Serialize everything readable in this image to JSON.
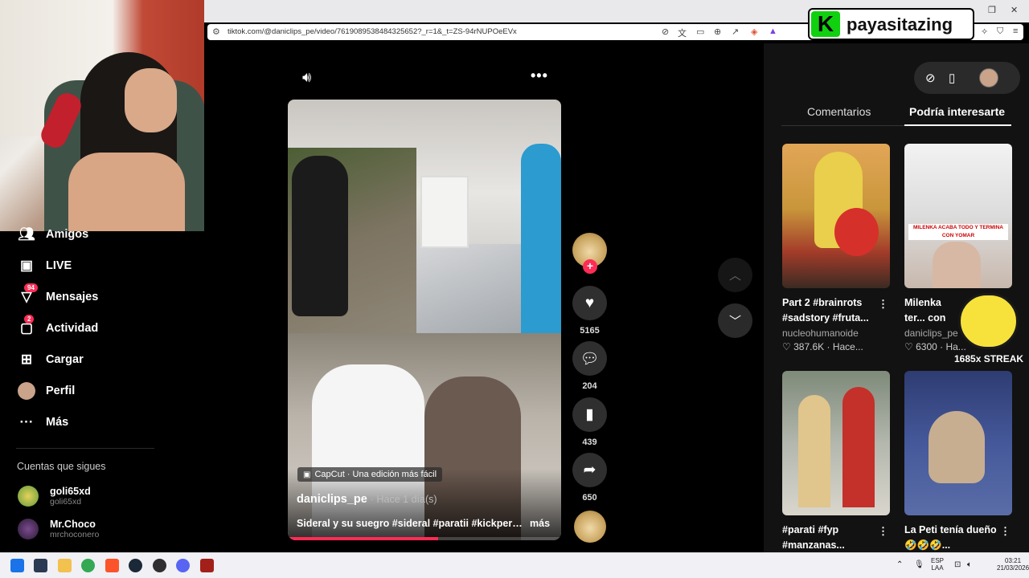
{
  "browser": {
    "url": "tiktok.com/@daniclips_pe/video/7619089538484325652?_r=1&_t=ZS-94rNUPOeEVx"
  },
  "overlay": {
    "logo_letter": "K",
    "channel_name": "payasitazing",
    "streak_text": "1685x STREAK"
  },
  "sidebar": {
    "items": [
      {
        "label": "Amigos",
        "icon": "friends-icon"
      },
      {
        "label": "LIVE",
        "icon": "live-icon"
      },
      {
        "label": "Mensajes",
        "icon": "messages-icon",
        "badge": "94"
      },
      {
        "label": "Actividad",
        "icon": "activity-icon",
        "badge": "2"
      },
      {
        "label": "Cargar",
        "icon": "upload-icon"
      },
      {
        "label": "Perfil",
        "icon": "profile-avatar"
      },
      {
        "label": "Más",
        "icon": "more-icon"
      }
    ],
    "following_header": "Cuentas que sigues",
    "following": [
      {
        "name": "goli65xd",
        "handle": "goli65xd"
      },
      {
        "name": "Mr.Choco",
        "handle": "mrchoconero"
      }
    ]
  },
  "video": {
    "author": "daniclips_pe",
    "time_ago": "· Hace 1 día(s)",
    "capcut_label": "CapCut · Una edición más fácil",
    "caption": "Sideral y su suegro #sideral #paratii #kickperu...",
    "more_label": "más",
    "progress": 0.55
  },
  "actions": {
    "likes": "5165",
    "comments": "204",
    "saves": "439",
    "shares": "650"
  },
  "right_panel": {
    "tabs": [
      "Comentarios",
      "Podría interesarte"
    ],
    "active_tab": "Podría interesarte",
    "cards": [
      {
        "title": "Part 2 #brainrots #sadstory #fruta...",
        "author": "nucleohumanoide",
        "likes": "387.6K",
        "time": "· Hace..."
      },
      {
        "title": "Milenka ter... con Yomar...",
        "author": "daniclips_pe",
        "likes": "6300",
        "time": "· Ha..."
      },
      {
        "title": "#parati #fyp #manzanas...",
        "author": "",
        "likes": "",
        "time": ""
      },
      {
        "title": "La Peti tenía dueño🤣🤣🤣...",
        "author": "",
        "likes": "",
        "time": ""
      }
    ],
    "thumb_caption": "MILENKA ACABA TODO Y TERMINA CON YOMAR"
  },
  "taskbar": {
    "lang": "ESP",
    "region": "LAA",
    "time": "03:21",
    "date": "21/03/2026"
  },
  "colors": {
    "accent": "#fe2c55",
    "logo_green": "#10d010"
  }
}
